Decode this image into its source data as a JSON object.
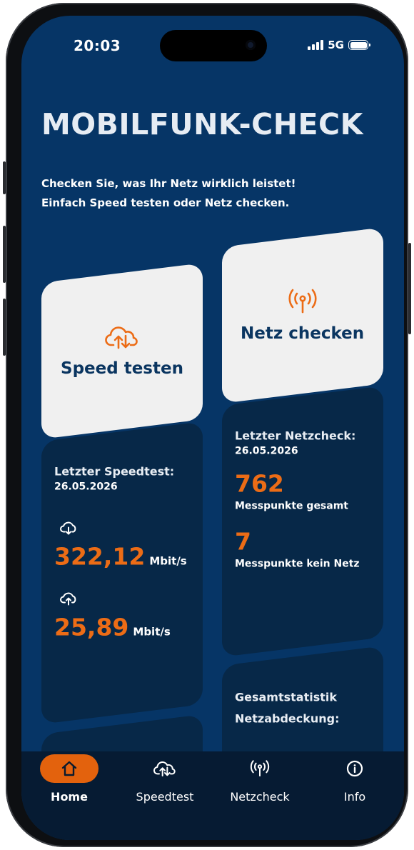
{
  "status_bar": {
    "time": "20:03",
    "network": "5G"
  },
  "header": {
    "title": "MOBILFUNK-CHECK",
    "subtitle_line1": "Checken Sie, was Ihr Netz wirklich leistet!",
    "subtitle_line2": "Einfach Speed testen oder Netz checken."
  },
  "actions": {
    "speed": {
      "label": "Speed testen",
      "icon": "cloud-upload-download-icon"
    },
    "network": {
      "label": "Netz checken",
      "icon": "antenna-signal-icon"
    }
  },
  "last_speedtest": {
    "title": "Letzter Speedtest:",
    "date": "26.05.2026",
    "download_value": "322,12",
    "download_unit": "Mbit/s",
    "upload_value": "25,89",
    "upload_unit": "Mbit/s"
  },
  "last_netcheck": {
    "title": "Letzter Netzcheck:",
    "date": "26.05.2026",
    "total_points": "762",
    "total_label": "Messpunkte gesamt",
    "no_network_points": "7",
    "no_network_label": "Messpunkte kein Netz"
  },
  "statistics": {
    "title_line1": "Gesamtstatistik",
    "title_line2": "Netzabdeckung:"
  },
  "nav": {
    "items": [
      {
        "label": "Home",
        "icon": "home-icon"
      },
      {
        "label": "Speedtest",
        "icon": "cloud-upload-download-icon"
      },
      {
        "label": "Netzcheck",
        "icon": "antenna-signal-icon"
      },
      {
        "label": "Info",
        "icon": "info-icon"
      }
    ],
    "active": "Home"
  },
  "colors": {
    "background": "#063566",
    "accent": "#ec6c16",
    "card_light": "#f0f0f0",
    "card_dark": "#072848",
    "nav": "#061b33"
  }
}
